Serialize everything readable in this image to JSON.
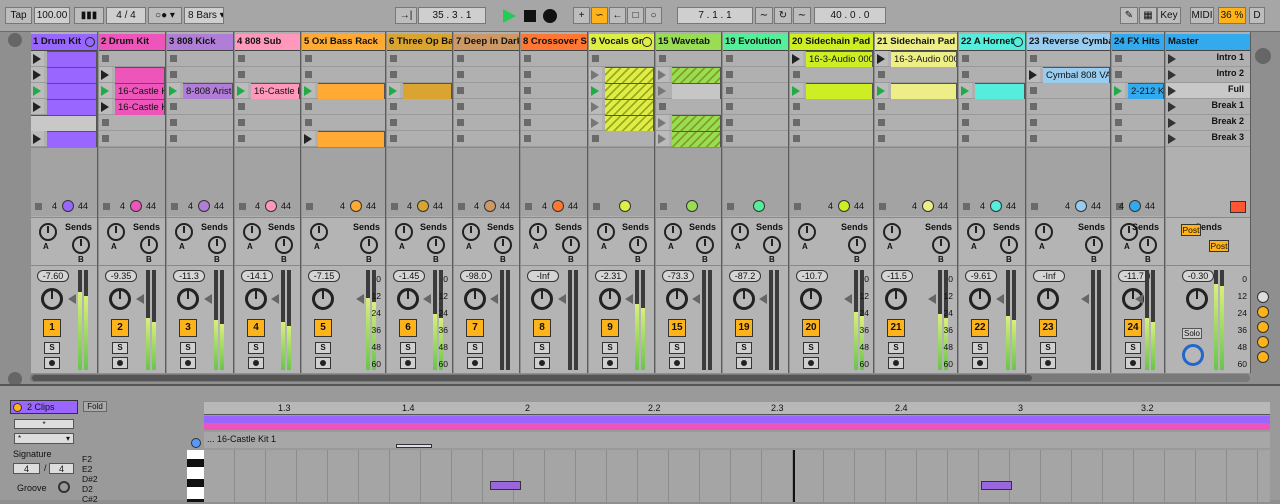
{
  "transport": {
    "tap": "Tap",
    "tempo": "100.00",
    "sig_num": "4",
    "sig_sep": "/",
    "sig_den": "4",
    "quant": "8 Bars",
    "position": "35 .   3 .   1",
    "loop_pos": "7 .   1 .   1",
    "loop_len": "40 .   0 .   0",
    "key": "Key",
    "midi": "MIDI",
    "cpu": "36 %",
    "d": "D"
  },
  "tracks": [
    {
      "name": "1 Drum Kit",
      "color": "#9966ff",
      "num": "1",
      "vol": "-7.60",
      "io": "4",
      "io2": "44"
    },
    {
      "name": "2 Drum Kit",
      "color": "#ee55bb",
      "num": "2",
      "vol": "-9.35",
      "io": "4",
      "io2": "44"
    },
    {
      "name": "3 808 Kick",
      "color": "#b07ed6",
      "num": "3",
      "vol": "-11.3",
      "io": "4",
      "io2": "44"
    },
    {
      "name": "4 808 Sub",
      "color": "#ff99bb",
      "num": "4",
      "vol": "-14.1",
      "io": "4",
      "io2": "44"
    },
    {
      "name": "5 Oxi Bass Rack",
      "color": "#ffaa33",
      "num": "5",
      "vol": "-7.15",
      "io": "4",
      "io2": "44"
    },
    {
      "name": "6 Three Op Ba",
      "color": "#d9a530",
      "num": "6",
      "vol": "-1.45",
      "io": "4",
      "io2": "44"
    },
    {
      "name": "7 Deep in Dark",
      "color": "#cc9966",
      "num": "7",
      "vol": "-98.0",
      "io": "4",
      "io2": "44"
    },
    {
      "name": "8 Crossover Sy",
      "color": "#ff7733",
      "num": "8",
      "vol": "-Inf",
      "io": "4",
      "io2": "44"
    },
    {
      "name": "9 Vocals Gr",
      "color": "#ddee44",
      "num": "9",
      "vol": "-2.31",
      "io": "",
      "io2": ""
    },
    {
      "name": "15 Wavetab",
      "color": "#99dd55",
      "num": "15",
      "vol": "-73.3",
      "io": "",
      "io2": ""
    },
    {
      "name": "19 Evolution",
      "color": "#55ee99",
      "num": "19",
      "vol": "-87.2",
      "io": "",
      "io2": ""
    },
    {
      "name": "20 Sidechain Pad",
      "color": "#ccee22",
      "num": "20",
      "vol": "-10.7",
      "io": "4",
      "io2": "44"
    },
    {
      "name": "21 Sidechain Pad",
      "color": "#eeee88",
      "num": "21",
      "vol": "-11.5",
      "io": "4",
      "io2": "44"
    },
    {
      "name": "22 A Hornet",
      "color": "#55eedd",
      "num": "22",
      "vol": "-9.61",
      "io": "4",
      "io2": "44"
    },
    {
      "name": "23 Reverse Cymbal",
      "color": "#99ccee",
      "num": "23",
      "vol": "-Inf",
      "io": "4",
      "io2": "44"
    },
    {
      "name": "24 FX Hits",
      "color": "#33aaee",
      "num": "24",
      "vol": "-11.7",
      "io": "4",
      "io2": "44"
    }
  ],
  "clips": {
    "c1": "16-Castle K",
    "c2": "16-Castle K",
    "c3": "8-808 Aristo",
    "c4": "16-Castle Ki",
    "c5": "16-3-Audio 0002",
    "c6": "16-3-Audio 0002",
    "c7": "Cymbal 808 VA9",
    "c8": "2-212 Ki"
  },
  "master": {
    "name": "Master",
    "vol": "-0.30",
    "solo": "Solo",
    "post1": "Post",
    "post2": "Post",
    "scenes": [
      "Intro 1",
      "Intro 2",
      "Full",
      "Break 1",
      "Break 2",
      "Break 3"
    ]
  },
  "labels": {
    "sends": "Sends",
    "a": "A",
    "b": "B",
    "s": "S",
    "scale": [
      "0",
      "12",
      "24",
      "36",
      "48",
      "60"
    ]
  },
  "detail": {
    "clips": "2 Clips",
    "fold": "Fold",
    "signature": "Signature",
    "sig_num": "4",
    "sig_den": "4",
    "groove": "Groove",
    "clip_name": "... 16-Castle Kit 1",
    "ruler": [
      "1.3",
      "1.4",
      "2",
      "2.2",
      "2.3",
      "2.4",
      "3",
      "3.2"
    ],
    "notes": [
      "F2",
      "E2",
      "D#2",
      "D2",
      "C#2"
    ]
  }
}
